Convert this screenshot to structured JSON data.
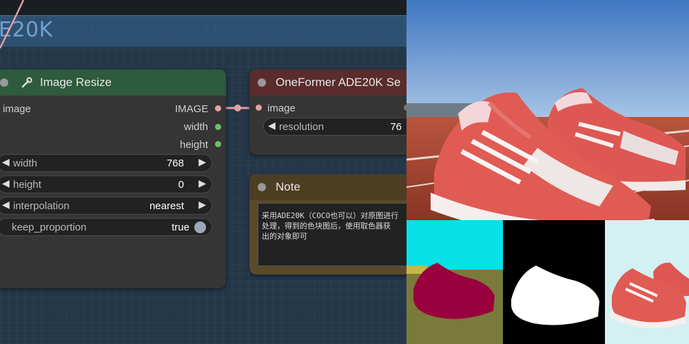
{
  "group": {
    "title": "E20K"
  },
  "resize_node": {
    "title": "Image Resize",
    "inputs": [
      "image"
    ],
    "outputs": [
      "IMAGE",
      "width",
      "height"
    ],
    "widgets": [
      {
        "label": "width",
        "value": "768"
      },
      {
        "label": "height",
        "value": "0"
      },
      {
        "label": "interpolation",
        "value": "nearest"
      }
    ],
    "toggle": {
      "label": "keep_proportion",
      "value": "true"
    }
  },
  "oneformer_node": {
    "title": "OneFormer ADE20K Se",
    "inputs": [
      "image"
    ],
    "widget": {
      "label": "resolution",
      "value": "76"
    }
  },
  "note_node": {
    "title": "Note",
    "text": "采用ADE20K（COCO也可以）对原图进行\n处理，得到的色块图后，使用取色器获\n出的对象即可"
  },
  "colors": {
    "image_port": "#e6a0a0",
    "int_port": "#6cbf6c",
    "bool_knob": "#9aa9bd",
    "link": "#e6a0a0"
  },
  "images": {
    "photo": "red sneakers on running track",
    "seg_map": "ADE20K segmentation map",
    "mask": "black and white shoe mask",
    "cutout": "sneakers on light blue background"
  }
}
